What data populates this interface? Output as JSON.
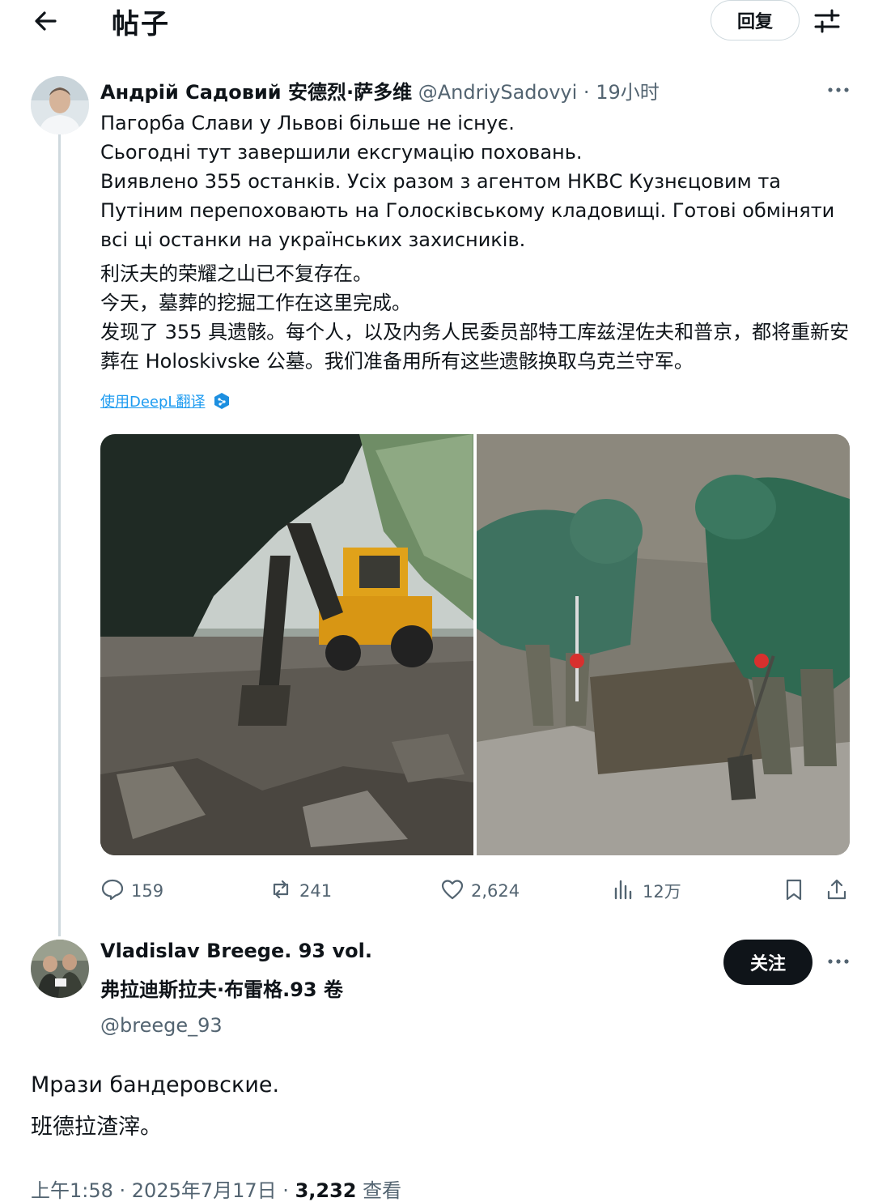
{
  "header": {
    "title": "帖子",
    "reply_label": "回复"
  },
  "post": {
    "author_name": "Андрій Садовий 安德烈·萨多维",
    "author_handle": "@AndriySadovyi",
    "time": "19小时",
    "text_ua": [
      "Пагорба Слави у Львові більше не існує.",
      "Сьогодні тут завершили ексгумацію поховань.",
      "Виявлено 355 останків. Усіх разом з агентом НКВС Кузнєцовим та Путіним перепоховають на Голосківському кладовищі. Готові обміняти всі ці останки на українських захисників."
    ],
    "text_zh": [
      "利沃夫的荣耀之山已不复存在。",
      "今天，墓葬的挖掘工作在这里完成。",
      "发现了 355 具遗骸。每个人，以及内务人民委员部特工库兹涅佐夫和普京，都将重新安葬在 Holoskivske 公墓。我们准备用所有这些遗骸换取乌克兰守军。"
    ],
    "translate_label": "使用DeepL翻译",
    "stats": {
      "replies": "159",
      "reposts": "241",
      "likes": "2,624",
      "views": "12万"
    }
  },
  "reply": {
    "author_name": "Vladislav Breege. 93 vol.",
    "author_name_zh": "弗拉迪斯拉夫·布雷格.93 卷",
    "author_handle": "@breege_93",
    "follow_label": "关注",
    "text": [
      "Мрази бандеровские.",
      "班德拉渣滓。"
    ],
    "time": "上午1:58 · 2025年7月17日 · ",
    "views_count": "3,232",
    "views_label": " 查看"
  },
  "colors": {
    "text_primary": "#0f1419",
    "text_secondary": "#536471",
    "link": "#1d9bf0",
    "border": "#cfd9de"
  }
}
